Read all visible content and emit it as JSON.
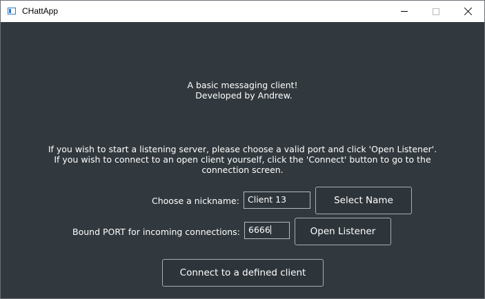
{
  "window": {
    "title": "CHattApp",
    "icon": "app-window-icon",
    "controls": [
      "minimize-icon",
      "maximize-icon",
      "close-icon"
    ]
  },
  "intro": {
    "line1": "A basic messaging client!",
    "line2": " Developed by Andrew."
  },
  "instructions": {
    "line1": "If you wish to start a listening server, please choose a valid port and click 'Open Listener'.",
    "line2": "If you wish to connect to an open client yourself, click the 'Connect' button to go to the",
    "line3": "connection screen."
  },
  "nickname": {
    "label": "Choose a nickname:",
    "value": "Client 13",
    "button": "Select Name"
  },
  "port": {
    "label": "Bound PORT for incoming connections:",
    "value": "6666",
    "button": "Open Listener"
  },
  "connect": {
    "button": "Connect to a defined client"
  },
  "colors": {
    "background": "#32393e",
    "text": "#ffffff",
    "border": "#a9afb4",
    "titlebar": "#ffffff"
  }
}
